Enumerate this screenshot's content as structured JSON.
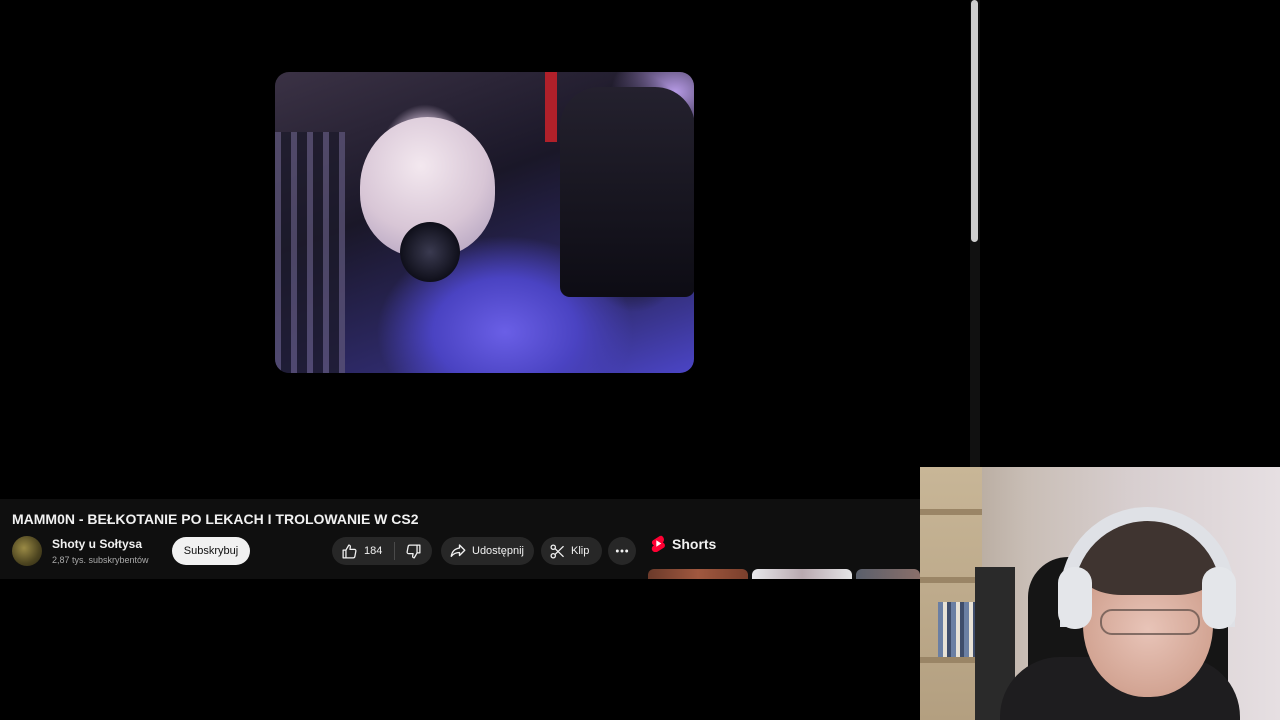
{
  "video": {
    "title": "MAMM0N - BEŁKOTANIE PO LEKACH I TROLOWANIE W CS2"
  },
  "channel": {
    "name": "Shoty u Sołtysa",
    "subscribers": "2,87 tys. subskrybentów",
    "subscribe_label": "Subskrybuj"
  },
  "actions": {
    "like_count": "184",
    "share_label": "Udostępnij",
    "clip_label": "Klip"
  },
  "shorts": {
    "label": "Shorts",
    "accent": "#ff0033"
  },
  "icons": [
    "thumbs-up-icon",
    "thumbs-down-icon",
    "share-arrow-icon",
    "scissors-icon",
    "more-horizontal-icon",
    "shorts-logo-icon"
  ],
  "colors": {
    "page_bg": "#000000",
    "info_bar_bg": "#0f0f0f",
    "pill_bg": "#272727",
    "text_primary": "#f1f1f1",
    "text_secondary": "#aaaaaa"
  }
}
